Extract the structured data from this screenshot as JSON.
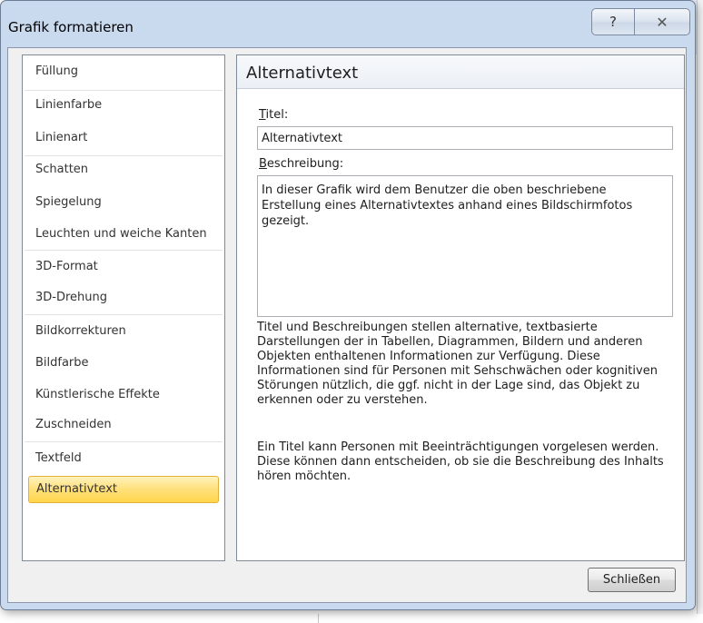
{
  "window": {
    "title": "Grafik formatieren",
    "help_glyph": "?",
    "close_glyph": "✕"
  },
  "nav": {
    "items": [
      {
        "label": "Füllung"
      },
      {
        "label": "Linienfarbe"
      },
      {
        "label": "Linienart"
      },
      {
        "label": "Schatten"
      },
      {
        "label": "Spiegelung"
      },
      {
        "label": "Leuchten und weiche Kanten"
      },
      {
        "label": "3D-Format"
      },
      {
        "label": "3D-Drehung"
      },
      {
        "label": "Bildkorrekturen"
      },
      {
        "label": "Bildfarbe"
      },
      {
        "label": "Künstlerische Effekte"
      },
      {
        "label": "Zuschneiden"
      },
      {
        "label": "Textfeld"
      },
      {
        "label": "Alternativtext"
      }
    ],
    "selected": "Alternativtext"
  },
  "panel": {
    "heading": "Alternativtext",
    "title_label_first": "T",
    "title_label_rest": "itel:",
    "title_value": "Alternativtext",
    "desc_label_first": "B",
    "desc_label_rest": "eschreibung:",
    "desc_value": "In dieser Grafik wird dem Benutzer die oben beschriebene Erstellung eines Alternativtextes anhand eines Bildschirmfotos gezeigt.",
    "info_1": "Titel und Beschreibungen stellen alternative, textbasierte Darstellungen der in Tabellen, Diagrammen, Bildern und anderen Objekten enthaltenen Informationen zur Verfügung. Diese Informationen sind für Personen mit Sehschwächen oder kognitiven Störungen nützlich, die ggf. nicht in der Lage sind, das Objekt zu erkennen oder zu verstehen.",
    "info_2": "Ein Titel kann Personen mit Beeinträchtigungen vorgelesen werden. Diese können dann entscheiden, ob sie die Beschreibung des Inhalts hören möchten."
  },
  "footer": {
    "close_label": "Schließen"
  }
}
